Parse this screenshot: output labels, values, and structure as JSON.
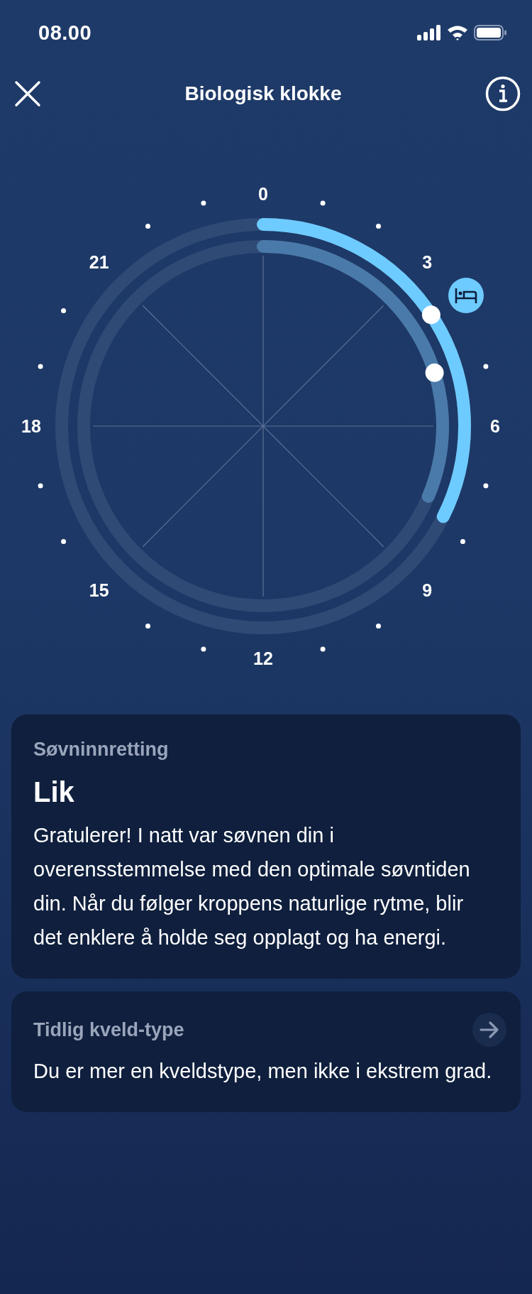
{
  "status_bar": {
    "time": "08.00"
  },
  "header": {
    "title": "Biologisk klokke"
  },
  "clock": {
    "hour_labels": [
      "0",
      "3",
      "6",
      "9",
      "12",
      "15",
      "18",
      "21"
    ]
  },
  "cards": [
    {
      "label": "Søvninnretting",
      "value": "Lik",
      "text": "Gratulerer! I natt var søvnen din i overensstemmelse med den optimale søvntiden din. Når du følger kroppens naturlige rytme, blir det enklere å holde seg opplagt og ha energi.",
      "has_link": false
    },
    {
      "label": "Tidlig kveld-type",
      "text": "Du er mer en kveldstype, men ikke i ekstrem grad.",
      "has_link": true
    }
  ]
}
